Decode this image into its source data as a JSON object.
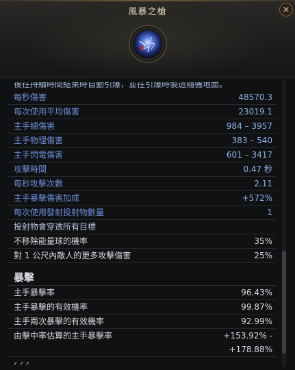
{
  "header": {
    "title": "風暴之槍",
    "close_icon": "×",
    "skill_icon": "storm-lance-skill-icon"
  },
  "scrolled_line": "後往持續時間結束時自動引爆，並往引爆時製造隨機地面。",
  "stats": [
    {
      "label": "每秒傷害",
      "value": "48570.3"
    },
    {
      "label": "每次使用平均傷害",
      "value": "23019.1"
    },
    {
      "label": "主手總傷害",
      "value": "984 – 3957"
    },
    {
      "label": "主手物理傷害",
      "value": "383 – 540"
    },
    {
      "label": "主手閃電傷害",
      "value": "601 – 3417"
    },
    {
      "label": "攻擊時間",
      "value": "0.47 秒"
    },
    {
      "label": "每秒攻擊次數",
      "value": "2.11"
    },
    {
      "label": "主手暴擊傷害加成",
      "value": "+572%"
    },
    {
      "label": "每次使用發射投射物數量",
      "value": "1"
    }
  ],
  "single_line": "投射物會穿透所有目標",
  "modifiers": [
    {
      "label": "不移除能量球的機率",
      "value": "35%"
    },
    {
      "label": "對 1 公尺內敵人的更多攻擊傷害",
      "value": "25%"
    }
  ],
  "crit_section": {
    "title": "暴擊",
    "rows": [
      {
        "label": "主手暴擊率",
        "value": "96.43%"
      },
      {
        "label": "主手暴擊的有效機率",
        "value": "99.87%"
      },
      {
        "label": "主手兩次暴擊的有效機率",
        "value": "92.99%"
      }
    ],
    "estimate": {
      "label": "由擊中率估算的主手暴擊率",
      "value_line1": "+153.92% -",
      "value_line2": "+178.88%"
    }
  },
  "tail_fragment": "ᐟ ᐟ ᐟ",
  "colors": {
    "stat_label": "#6c8dd8",
    "stat_value": "#8fb1e8",
    "title_gold": "#e2d6bb"
  }
}
